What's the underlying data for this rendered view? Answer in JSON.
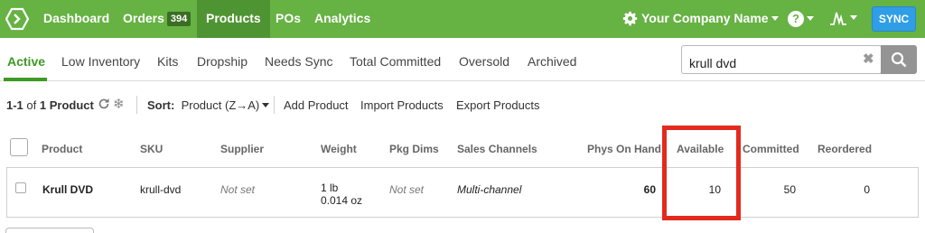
{
  "nav": {
    "items": [
      {
        "label": "Dashboard"
      },
      {
        "label": "Orders",
        "badge": "394"
      },
      {
        "label": "Products"
      },
      {
        "label": "POs"
      },
      {
        "label": "Analytics"
      }
    ],
    "company": "Your Company Name",
    "sync_label": "SYNC"
  },
  "tabs": [
    "Active",
    "Low Inventory",
    "Kits",
    "Dropship",
    "Needs Sync",
    "Total Committed",
    "Oversold",
    "Archived"
  ],
  "search": {
    "value": "krull dvd"
  },
  "toolbar": {
    "count_range": "1-1",
    "count_of": "of",
    "count_total": "1 Product",
    "sort_label": "Sort:",
    "sort_value": "Product (Z→A)",
    "add_product": "Add Product",
    "import_products": "Import Products",
    "export_products": "Export Products"
  },
  "table": {
    "headers": [
      "Product",
      "SKU",
      "Supplier",
      "Weight",
      "Pkg Dims",
      "Sales Channels",
      "Phys On Hand",
      "Available",
      "Committed",
      "Reordered"
    ],
    "rows": [
      {
        "product": "Krull DVD",
        "sku": "krull-dvd",
        "supplier": "Not set",
        "weight_1": "1 lb",
        "weight_2": "0.014 oz",
        "pkg_dims": "Not set",
        "sales_channels": "Multi-channel",
        "phys_on_hand": "60",
        "available": "10",
        "committed": "50",
        "reordered": "0"
      }
    ]
  },
  "colors": {
    "nav_bg": "#66b243",
    "accent": "#3d9a23",
    "sync": "#2f9ee6",
    "highlight": "#e32a1e"
  }
}
